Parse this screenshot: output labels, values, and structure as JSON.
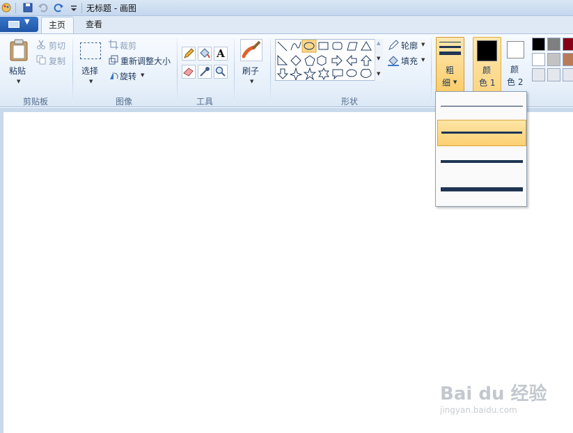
{
  "window": {
    "title": "无标题 - 画图"
  },
  "tabs": [
    {
      "label": "主页",
      "active": true
    },
    {
      "label": "查看",
      "active": false
    }
  ],
  "clipboard": {
    "paste": "粘贴",
    "cut": "剪切",
    "copy": "复制",
    "group": "剪贴板"
  },
  "image": {
    "select": "选择",
    "crop": "裁剪",
    "resize": "重新调整大小",
    "rotate": "旋转",
    "group": "图像"
  },
  "tools": {
    "text_glyph": "A",
    "group": "工具"
  },
  "brushes": {
    "label": "刷子"
  },
  "shapes": {
    "outline": "轮廓",
    "fill": "填充",
    "group": "形状"
  },
  "size": {
    "label_1": "粗",
    "label_2": "细",
    "options": [
      "1px",
      "3px",
      "5px",
      "8px"
    ],
    "selected_index": 1
  },
  "colors": {
    "color1_a": "颜",
    "color1_b": "色 1",
    "color2_a": "颜",
    "color2_b": "色 2",
    "color1_value": "#000000",
    "color2_value": "#ffffff",
    "palette": [
      "#000000",
      "#7f7f7f",
      "#880015",
      "#ffffff",
      "#c3c3c3",
      "#b97a57",
      "#e4e8ee",
      "#e4e8ee",
      "#e4e8ee"
    ]
  },
  "watermark": {
    "brand": "Bai du 经验",
    "url": "jingyan.baidu.com"
  }
}
